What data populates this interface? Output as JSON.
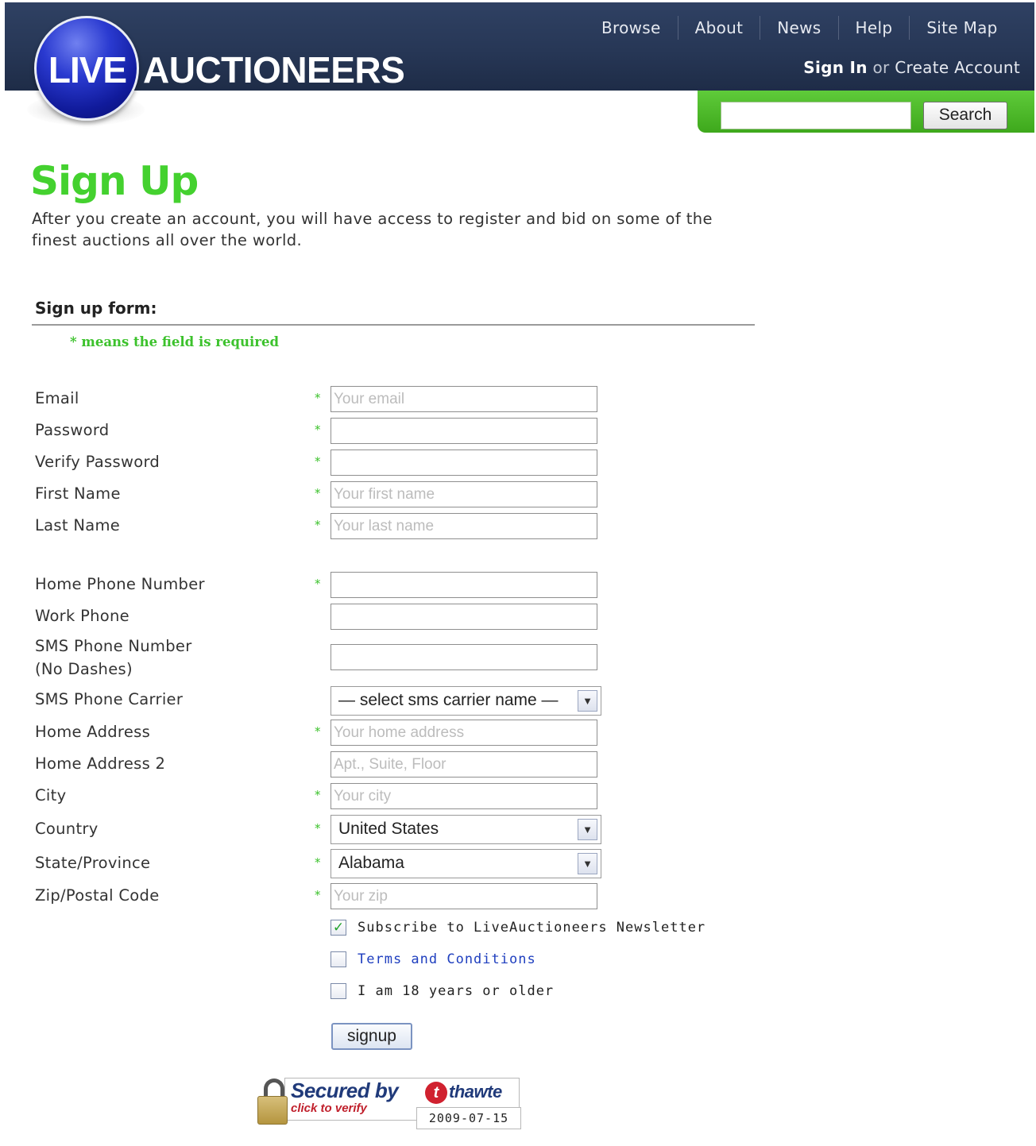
{
  "header": {
    "logo_live": "LIVE",
    "logo_auctioneers": "AUCTIONEERS",
    "nav": [
      "Browse",
      "About",
      "News",
      "Help",
      "Site Map"
    ],
    "sign_in": "Sign In",
    "or": "or",
    "create_account": "Create Account",
    "search_value": "",
    "search_button": "Search",
    "accent_green": "#44d12f",
    "header_navy": "#273756"
  },
  "page": {
    "title": "Sign Up",
    "intro": "After you create an account, you will have access to register and bid on some of the finest auctions all over the world.",
    "form_heading": "Sign up form:",
    "required_note": "* means the field is required"
  },
  "form": {
    "email": {
      "label": "Email",
      "placeholder": "Your email",
      "required": true
    },
    "password": {
      "label": "Password",
      "placeholder": "",
      "required": true
    },
    "verify_password": {
      "label": "Verify Password",
      "placeholder": "",
      "required": true
    },
    "first_name": {
      "label": "First Name",
      "placeholder": "Your first name",
      "required": true
    },
    "last_name": {
      "label": "Last Name",
      "placeholder": "Your last name",
      "required": true
    },
    "home_phone": {
      "label": "Home Phone Number",
      "placeholder": "",
      "required": true
    },
    "work_phone": {
      "label": "Work Phone",
      "placeholder": "",
      "required": false
    },
    "sms_phone": {
      "label_line1": "SMS Phone Number",
      "label_line2": "(No Dashes)",
      "placeholder": "",
      "required": false
    },
    "sms_carrier": {
      "label": "SMS Phone Carrier",
      "selected": "— select sms carrier name —",
      "required": false
    },
    "home_address": {
      "label": "Home Address",
      "placeholder": "Your home address",
      "required": true
    },
    "home_address_2": {
      "label": "Home Address 2",
      "placeholder": "Apt., Suite, Floor",
      "required": false
    },
    "city": {
      "label": "City",
      "placeholder": "Your city",
      "required": true
    },
    "country": {
      "label": "Country",
      "selected": "United States",
      "required": true
    },
    "state": {
      "label": "State/Province",
      "selected": "Alabama",
      "required": true
    },
    "zip": {
      "label": "Zip/Postal Code",
      "placeholder": "Your zip",
      "required": true
    },
    "required_mark": "*",
    "newsletter": {
      "label": "Subscribe to LiveAuctioneers Newsletter",
      "checked": true
    },
    "terms": {
      "label": "Terms and Conditions",
      "checked": false
    },
    "age": {
      "label": "I am 18 years or older",
      "checked": false
    },
    "submit_label": "signup"
  },
  "badge": {
    "secured_by": "Secured by",
    "brand": "thawte",
    "brand_mark": "t",
    "click_to_verify": "click to verify",
    "date": "2009-07-15",
    "icon": "padlock-icon"
  }
}
